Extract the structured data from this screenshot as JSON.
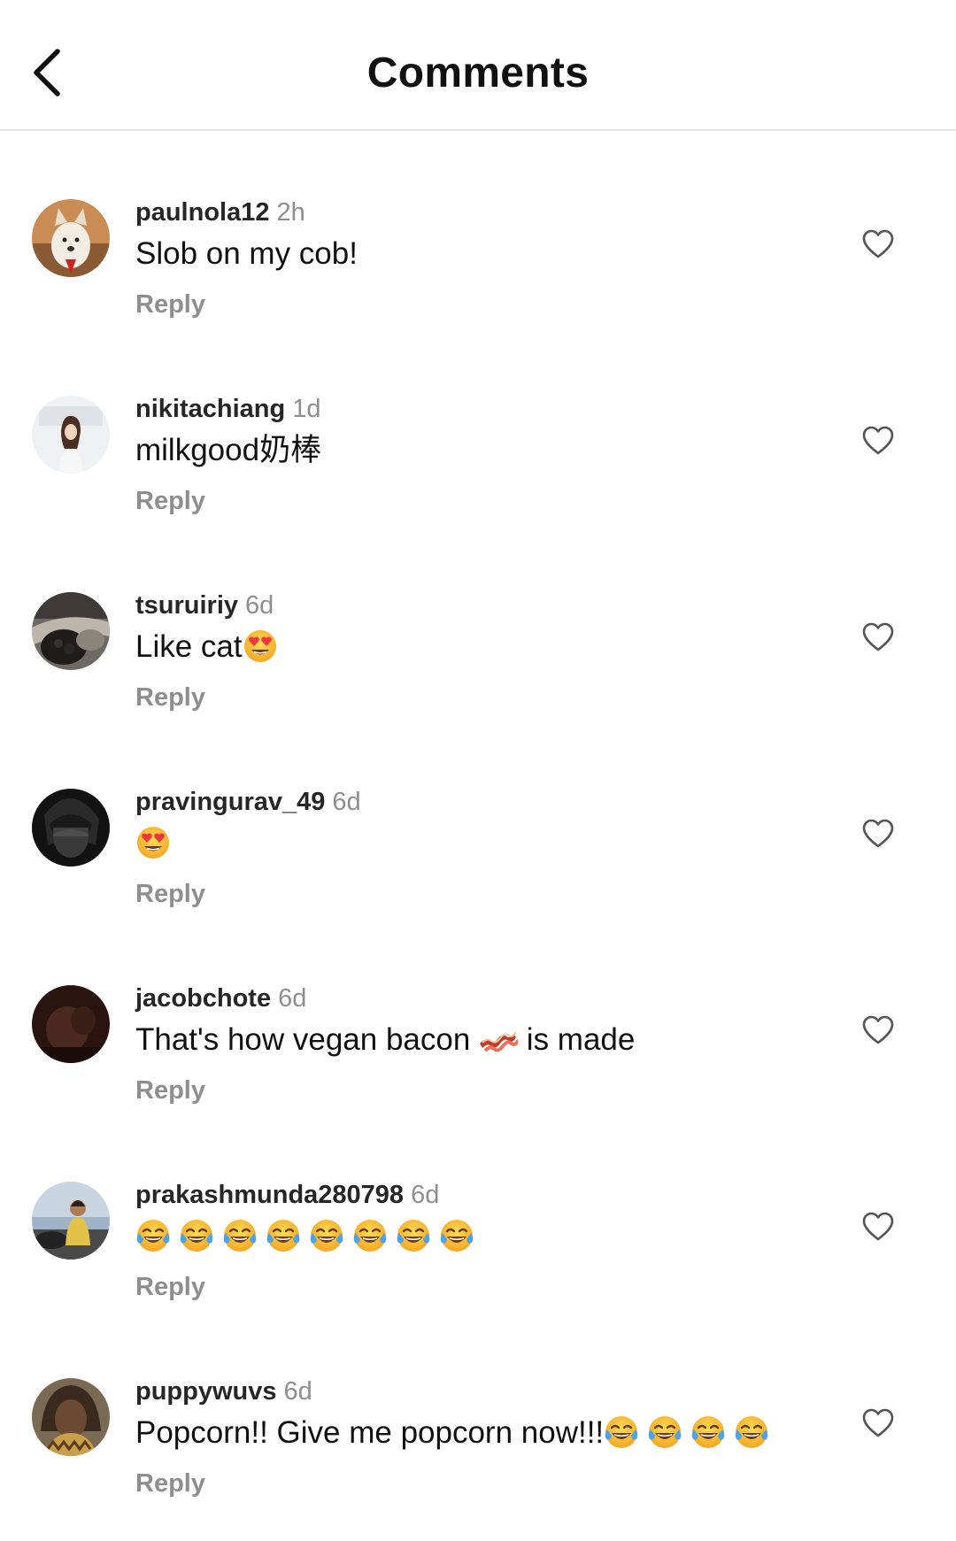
{
  "header": {
    "title": "Comments",
    "back_icon": "chevron-left-icon"
  },
  "reply_label": "Reply",
  "like_icon": "heart-outline-icon",
  "comments": [
    {
      "username": "paulnola12",
      "time": "2h",
      "text": "Slob on my cob!",
      "emoji": [],
      "text_after": "",
      "avatar": "dog-photo"
    },
    {
      "username": "nikitachiang",
      "time": "1d",
      "text": "milkgood奶棒",
      "emoji": [],
      "text_after": "",
      "avatar": "woman-photo"
    },
    {
      "username": "tsuruiriy",
      "time": "6d",
      "text": "Like cat",
      "emoji": [
        "heart-eyes"
      ],
      "text_after": "",
      "avatar": "cat-photo"
    },
    {
      "username": "pravingurav_49",
      "time": "6d",
      "text": "",
      "emoji": [
        "heart-eyes"
      ],
      "text_after": "",
      "avatar": "anime-portrait"
    },
    {
      "username": "jacobchote",
      "time": "6d",
      "text": "That's how vegan bacon",
      "emoji": [
        "bacon"
      ],
      "text_after": "is made",
      "avatar": "dark-portrait"
    },
    {
      "username": "prakashmunda280798",
      "time": "6d",
      "text": "",
      "emoji": [
        "joy",
        "joy",
        "joy",
        "joy",
        "joy",
        "joy",
        "joy",
        "joy"
      ],
      "text_after": "",
      "avatar": "man-outdoor-photo"
    },
    {
      "username": "puppywuvs",
      "time": "6d",
      "text": "Popcorn!! Give me popcorn now!!!",
      "emoji": [
        "joy",
        "joy",
        "joy",
        "joy"
      ],
      "text_after": "",
      "avatar": "person-photo"
    }
  ],
  "colors": {
    "text": "#111111",
    "secondary": "#8e8e8e",
    "divider": "#e4e4e4",
    "emoji_yellow": "#ffc93a",
    "emoji_heart": "#f0353f",
    "emoji_tear": "#4aa3f0"
  }
}
